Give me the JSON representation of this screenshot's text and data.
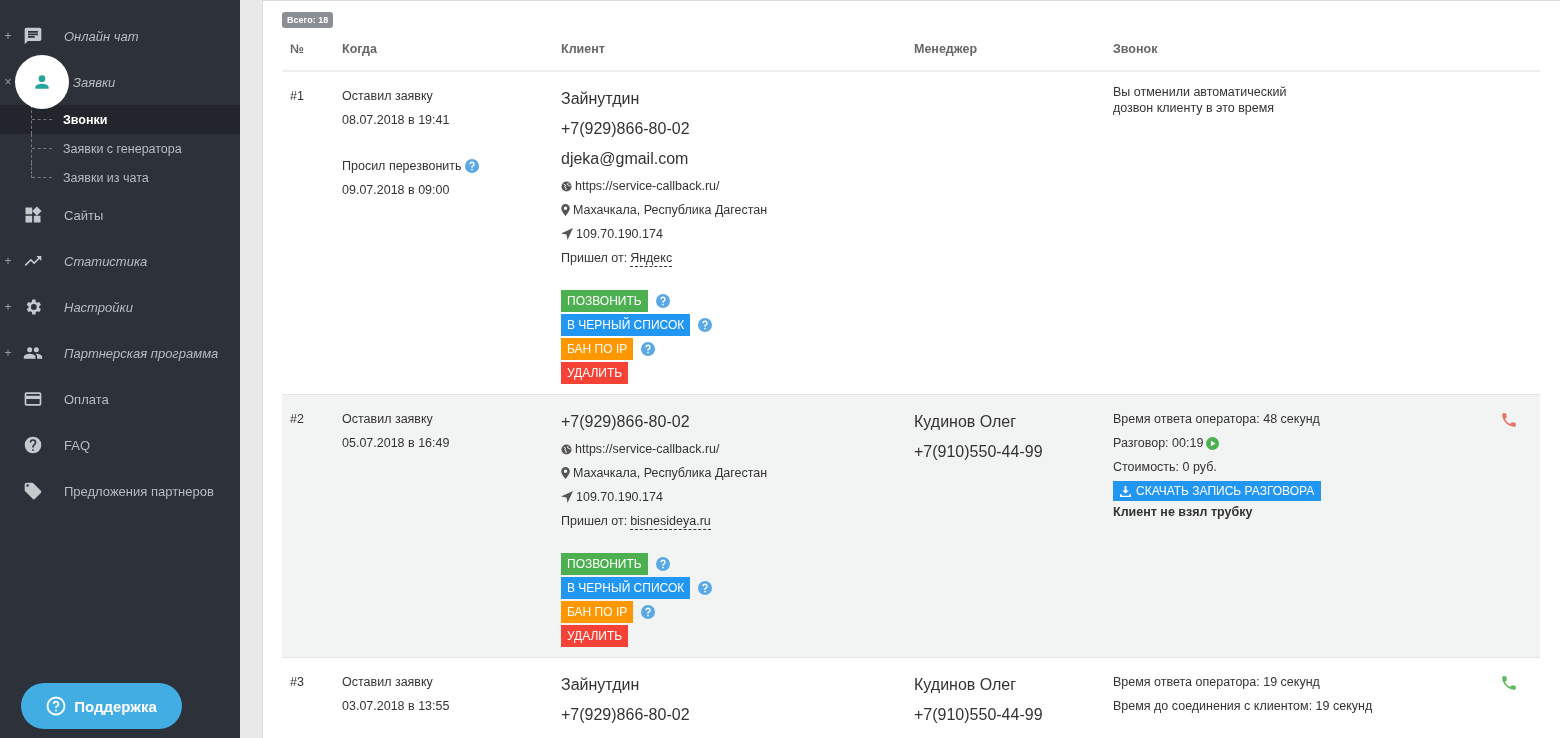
{
  "sidebar": {
    "items": [
      {
        "label": "Онлайн чат",
        "kind": "chat",
        "toggle": "+",
        "expandable": true,
        "selected": false
      },
      {
        "label": "Заявки",
        "kind": "person",
        "toggle": "×",
        "expandable": true,
        "selected": true,
        "children": [
          {
            "label": "Звонки",
            "selected": true
          },
          {
            "label": "Заявки с генератора",
            "selected": false
          },
          {
            "label": "Заявки из чата",
            "selected": false
          }
        ]
      },
      {
        "label": "Сайты",
        "kind": "widgets",
        "expandable": false,
        "selected": false
      },
      {
        "label": "Статистика",
        "kind": "trend",
        "toggle": "+",
        "expandable": true,
        "selected": false
      },
      {
        "label": "Настройки",
        "kind": "gear",
        "toggle": "+",
        "expandable": true,
        "selected": false
      },
      {
        "label": "Партнерская программа",
        "kind": "people",
        "toggle": "+",
        "expandable": true,
        "selected": false
      },
      {
        "label": "Оплата",
        "kind": "card",
        "expandable": false,
        "selected": false
      },
      {
        "label": "FAQ",
        "kind": "help",
        "expandable": false,
        "selected": false
      },
      {
        "label": "Предложения партнеров",
        "kind": "tag",
        "expandable": false,
        "selected": false
      }
    ],
    "support_button": "Поддержка"
  },
  "total_badge": "Всего: 18",
  "table": {
    "columns": [
      "№",
      "Когда",
      "Клиент",
      "Менеджер",
      "Звонок"
    ],
    "rows": [
      {
        "number": "#1",
        "highlighted": false,
        "created_label": "Оставил заявку",
        "created_at": "08.07.2018 в 19:41",
        "callback": {
          "label": "Просил перезвонить",
          "at": "09.07.2018 в 09:00"
        },
        "client": {
          "name": "Зайнутдин",
          "phone": "+7(929)866-80-02",
          "email": "djeka@gmail.com",
          "url": "https://service-callback.ru/",
          "location": "Махачкала, Республика Дагестан",
          "ip": "109.70.190.174",
          "source_label": "Пришел от:",
          "source": "Яндекс"
        },
        "actions": [
          {
            "label": "ПОЗВОНИТЬ",
            "kind": "call",
            "help": true
          },
          {
            "label": "В ЧЕРНЫЙ СПИСОК",
            "kind": "blacklist",
            "help": true
          },
          {
            "label": "БАН ПО IP",
            "kind": "ban",
            "help": true
          },
          {
            "label": "УДАЛИТЬ",
            "kind": "delete",
            "help": false
          }
        ],
        "call": [
          {
            "kind": "note",
            "text": "Вы отменили автоматический дозвон клиенту в это время"
          }
        ]
      },
      {
        "number": "#2",
        "highlighted": true,
        "created_label": "Оставил заявку",
        "created_at": "05.07.2018 в 16:49",
        "client": {
          "phone": "+7(929)866-80-02",
          "url": "https://service-callback.ru/",
          "location": "Махачкала, Республика Дагестан",
          "ip": "109.70.190.174",
          "source_label": "Пришел от:",
          "source": "bisnesideya.ru"
        },
        "actions": [
          {
            "label": "ПОЗВОНИТЬ",
            "kind": "call",
            "help": true
          },
          {
            "label": "В ЧЕРНЫЙ СПИСОК",
            "kind": "blacklist",
            "help": true
          },
          {
            "label": "БАН ПО IP",
            "kind": "ban",
            "help": true
          },
          {
            "label": "УДАЛИТЬ",
            "kind": "delete",
            "help": false
          }
        ],
        "manager": {
          "name": "Кудинов Олег",
          "phone": "+7(910)550-44-99"
        },
        "call": [
          {
            "kind": "text",
            "text": "Время ответа оператора: 48 секунд"
          },
          {
            "kind": "play",
            "text": "Разговор: 00:19"
          },
          {
            "kind": "text",
            "text": "Стоимость: 0 руб."
          },
          {
            "kind": "download",
            "text": "СКАЧАТЬ ЗАПИСЬ РАЗГОВОРА"
          },
          {
            "kind": "result",
            "text": "Клиент не взял трубку"
          }
        ],
        "call_icon": {
          "color": "#e57368"
        }
      },
      {
        "number": "#3",
        "highlighted": false,
        "created_label": "Оставил заявку",
        "created_at": "03.07.2018 в 13:55",
        "client": {
          "name": "Зайнутдин",
          "phone": "+7(929)866-80-02"
        },
        "manager": {
          "name": "Кудинов Олег",
          "phone": "+7(910)550-44-99"
        },
        "call": [
          {
            "kind": "text",
            "text": "Время ответа оператора: 19 секунд"
          },
          {
            "kind": "text",
            "text": "Время до соединения с клиентом: 19 секунд"
          }
        ],
        "call_icon": {
          "color": "#5cb85c"
        }
      }
    ]
  }
}
